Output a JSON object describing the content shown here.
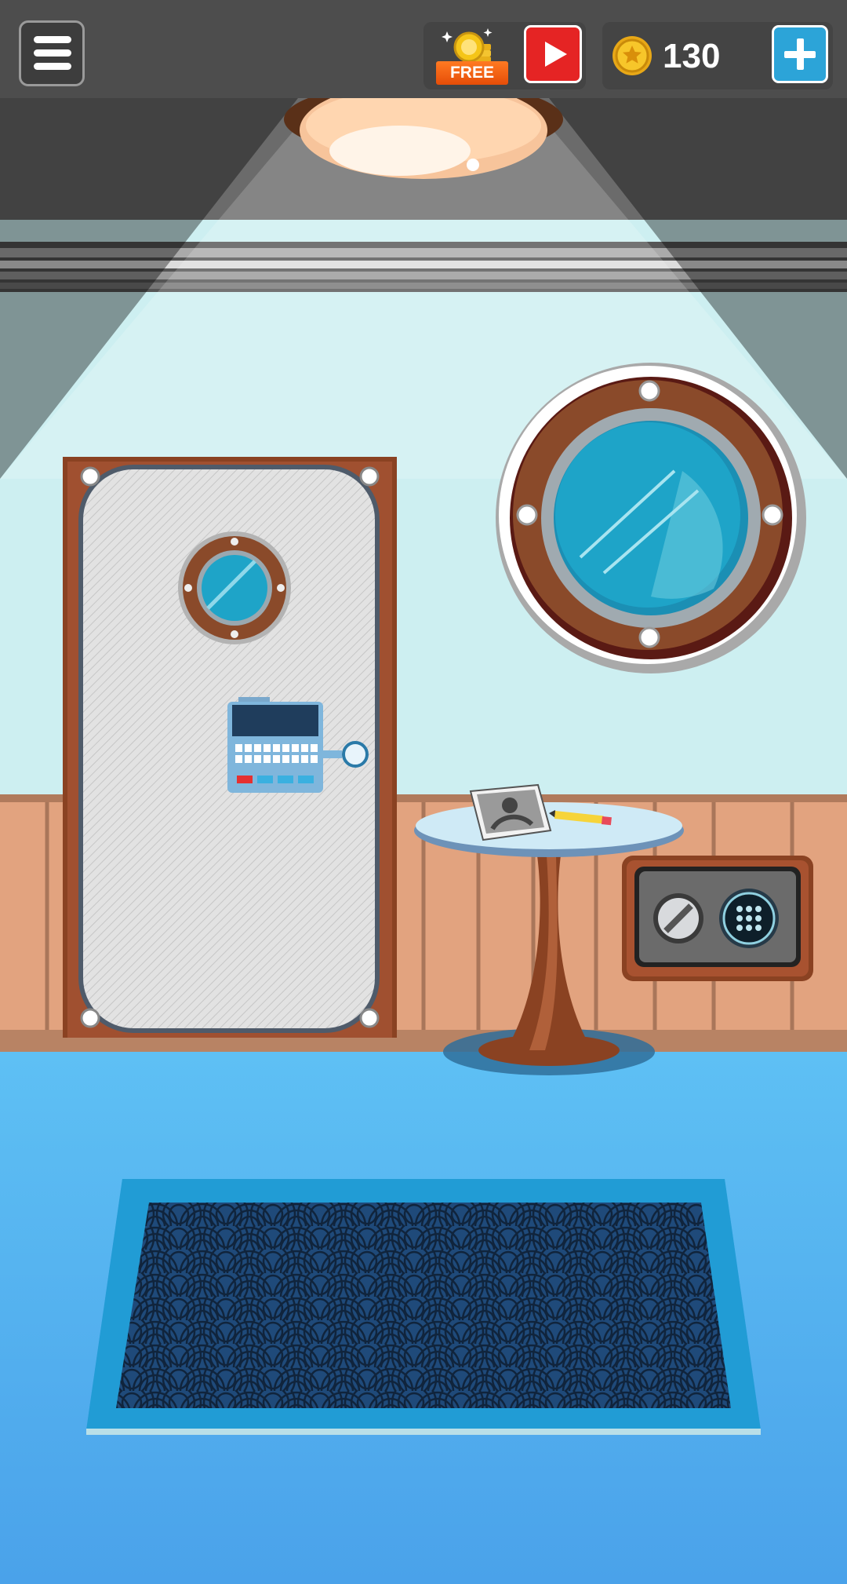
{
  "hud": {
    "menu_icon": "hamburger-menu-icon",
    "free_badge": {
      "label": "FREE",
      "icon": "coin-reward-icon"
    },
    "video_icon": "play-video-icon",
    "coins": {
      "count": "130",
      "icon": "gold-coin-icon",
      "add_icon": "plus-icon"
    }
  },
  "scene": {
    "objects": [
      "ceiling-lamp",
      "cabin-door",
      "door-porthole",
      "door-keypad",
      "wall-porthole",
      "side-table",
      "photo",
      "pencil",
      "wall-safe",
      "floor-rug"
    ]
  },
  "colors": {
    "topbar": "#4d4d4d",
    "wall": "#cdeff1",
    "wainscot": "#e2a37f",
    "floor": "#4aa2ea",
    "rug": "#1f4a7a",
    "door_frame": "#8a4222",
    "video_button": "#e52424",
    "add_button": "#2ca4d8"
  }
}
